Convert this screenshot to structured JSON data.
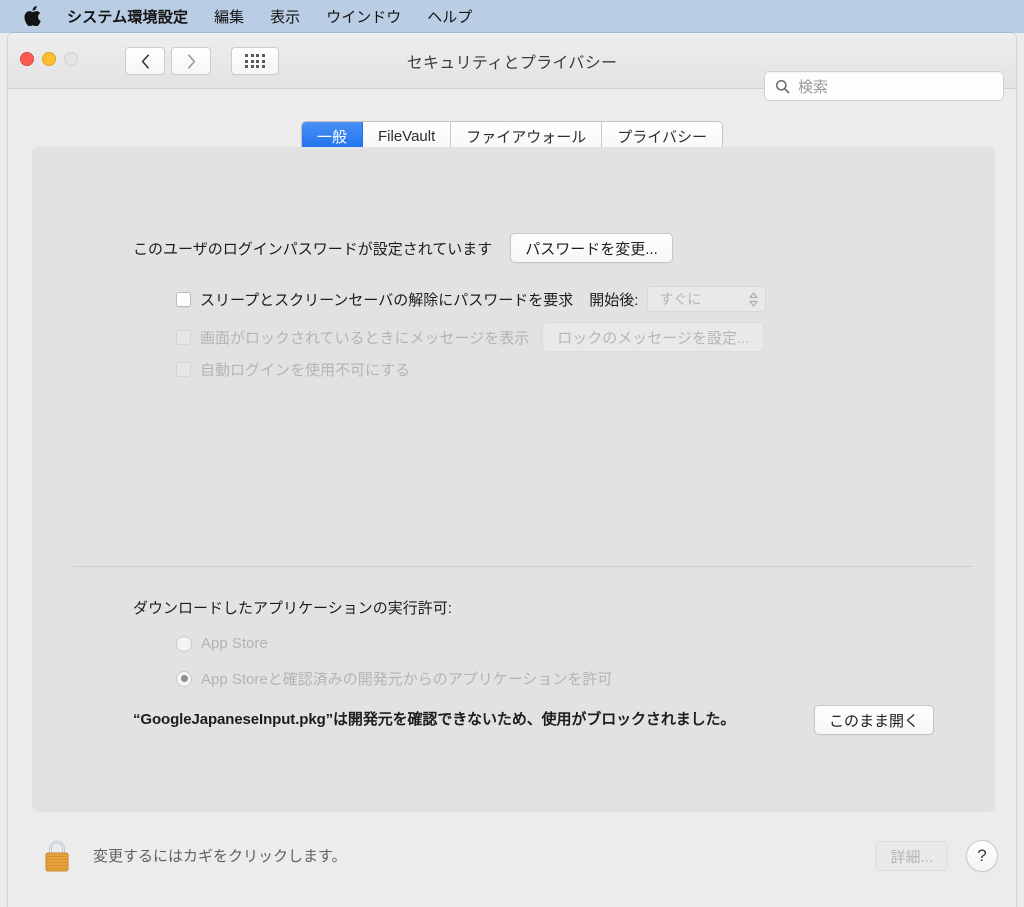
{
  "menubar": {
    "apple_icon": "apple-logo-icon",
    "app_name": "システム環境設定",
    "items": [
      {
        "label": "編集"
      },
      {
        "label": "表示"
      },
      {
        "label": "ウインドウ"
      },
      {
        "label": "ヘルプ"
      }
    ]
  },
  "window": {
    "title": "セキュリティとプライバシー",
    "traffic_lights": {
      "close": "close-button",
      "minimize": "minimize-button",
      "zoom": "zoom-button-disabled"
    },
    "nav": {
      "back_icon": "chevron-left-icon",
      "forward_icon": "chevron-right-icon",
      "grid_icon": "grid-view-icon"
    },
    "search": {
      "icon": "search-icon",
      "placeholder": "検索",
      "value": ""
    }
  },
  "tabs": [
    {
      "label": "一般",
      "active": true
    },
    {
      "label": "FileVault",
      "active": false
    },
    {
      "label": "ファイアウォール",
      "active": false
    },
    {
      "label": "プライバシー",
      "active": false
    }
  ],
  "general": {
    "password_status": "このユーザのログインパスワードが設定されています",
    "change_password_button": "パスワードを変更...",
    "checkboxes": [
      {
        "label": "スリープとスクリーンセーバの解除にパスワードを要求",
        "checked": false,
        "disabled": false
      },
      {
        "label": "画面がロックされているときにメッセージを表示",
        "checked": false,
        "disabled": true
      },
      {
        "label": "自動ログインを使用不可にする",
        "checked": false,
        "disabled": true
      }
    ],
    "delay": {
      "label": "開始後:",
      "value": "すぐに",
      "disabled": true,
      "stepper_icon": "stepper-updown-icon"
    },
    "lock_message_button": {
      "label": "ロックのメッセージを設定...",
      "disabled": true
    }
  },
  "downloads": {
    "heading": "ダウンロードしたアプリケーションの実行許可:",
    "options": [
      {
        "label": "App Store",
        "selected": false,
        "disabled": true
      },
      {
        "label": "App Storeと確認済みの開発元からのアプリケーションを許可",
        "selected": true,
        "disabled": true
      }
    ],
    "blocked_message": "“GoogleJapaneseInput.pkg”は開発元を確認できないため、使用がブロックされました。",
    "open_anyway_button": "このまま開く"
  },
  "footer": {
    "lock_icon": "lock-closed-icon",
    "lock_text": "変更するにはカギをクリックします。",
    "advanced_button": {
      "label": "詳細...",
      "disabled": true
    },
    "help_button": "?"
  },
  "colors": {
    "menubar_bg": "#b9cde4",
    "window_bg": "#ececec",
    "panel_bg": "#e2e2e2",
    "accent_blue": "#1d72ed",
    "traffic_red": "#fb5c55",
    "traffic_yellow": "#fcbd2e",
    "lock_gold": "#e8a33d"
  }
}
